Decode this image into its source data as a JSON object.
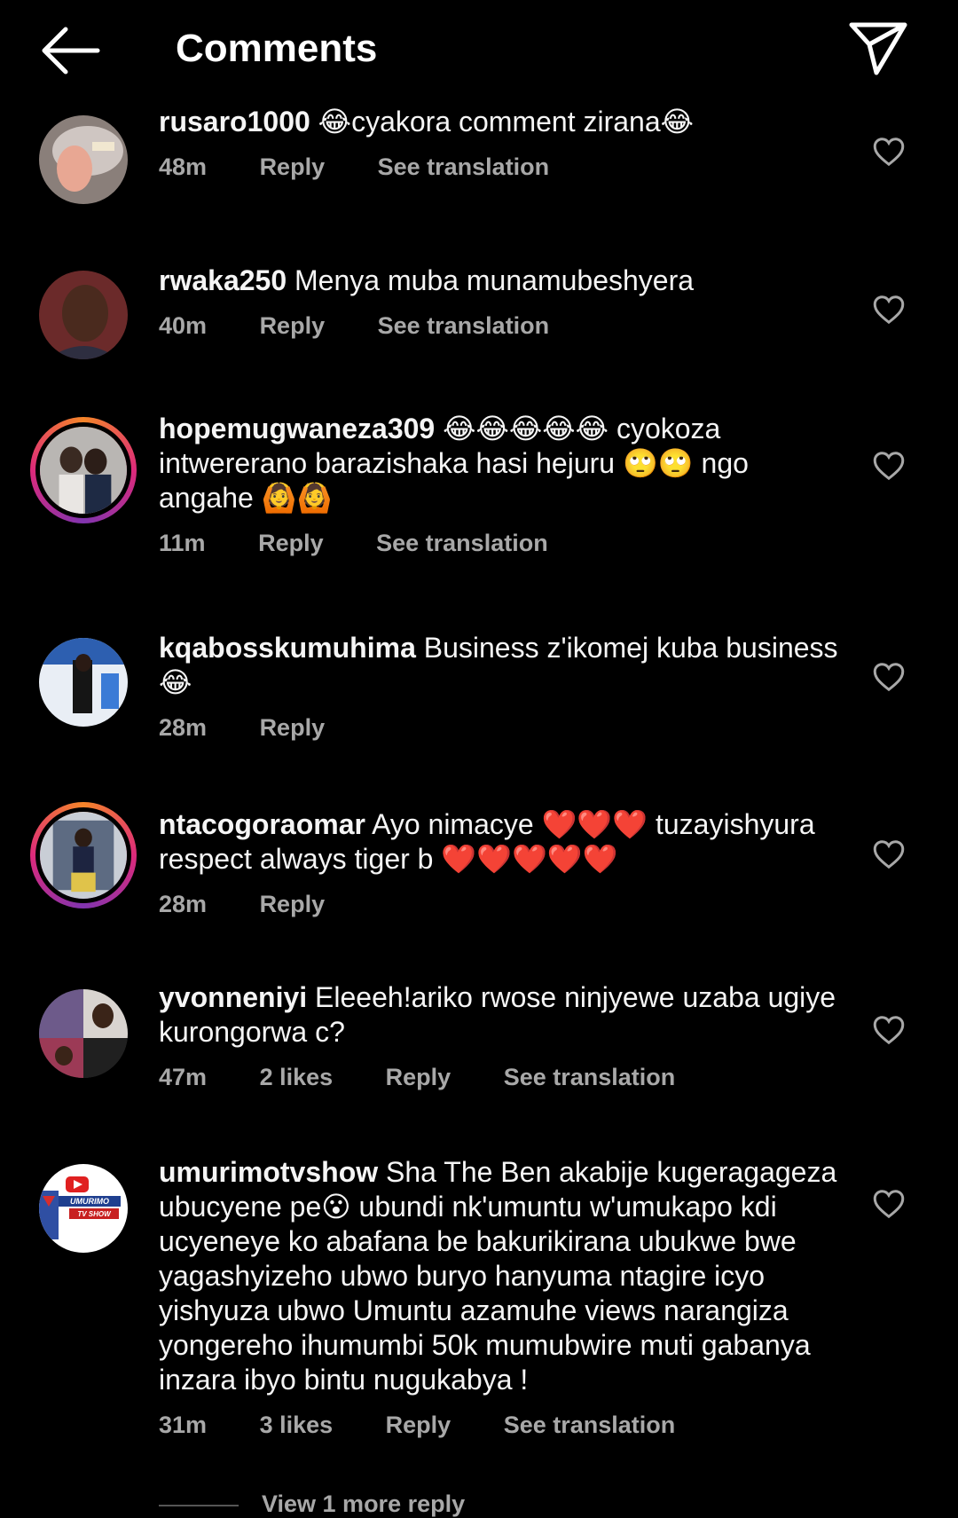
{
  "header": {
    "title": "Comments"
  },
  "meta_labels": {
    "reply": "Reply",
    "see_translation": "See translation"
  },
  "comments": [
    {
      "username": "rusaro1000",
      "text": " 😂cyakora comment zirana😂",
      "time": "48m",
      "likes": "",
      "translate": true,
      "ring": false
    },
    {
      "username": "rwaka250",
      "text": " Menya muba munamubeshyera",
      "time": "40m",
      "likes": "",
      "translate": true,
      "ring": false
    },
    {
      "username": "hopemugwaneza309",
      "text": " 😂😂😂😂😂 cyokoza intwererano barazishaka hasi hejuru 🙄🙄 ngo angahe 🙆🙆",
      "time": "11m",
      "likes": "",
      "translate": true,
      "ring": true
    },
    {
      "username": "kqabosskumuhima",
      "text": " Business z'ikomej kuba business 😂",
      "time": "28m",
      "likes": "",
      "translate": false,
      "ring": false
    },
    {
      "username": "ntacogoraomar",
      "text": " Ayo nimacye ❤️❤️❤️ tuzayishyura respect always tiger b ❤️❤️❤️❤️❤️",
      "time": "28m",
      "likes": "",
      "translate": false,
      "ring": true
    },
    {
      "username": "yvonneniyi",
      "text": " Eleeeh!ariko rwose ninjyewe uzaba ugiye kurongorwa c?",
      "time": "47m",
      "likes": "2 likes",
      "translate": true,
      "ring": false
    },
    {
      "username": "umurimotvshow",
      "text": " Sha The Ben akabije kugeragageza ubucyene pe😮 ubundi nk'umuntu w'umukapo kdi ucyeneye ko abafana be bakurikirana ubukwe bwe yagashyizeho ubwo buryo hanyuma ntagire icyo yishyuza ubwo Umuntu azamuhe views narangiza yongereho ihumumbi 50k  mumubwire muti gabanya inzara ibyo bintu nugukabya !",
      "time": "31m",
      "likes": "3 likes",
      "translate": true,
      "ring": false
    }
  ],
  "view_more_replies": "View 1 more reply",
  "avatar_text": {
    "umurimo_line1": "UMURIMO",
    "umurimo_line2": "TV SHOW"
  },
  "colors": {
    "background": "#000000",
    "meta": "#a8a8a8",
    "story_ring": [
      "#f58529",
      "#dd2a7b",
      "#8134af"
    ]
  }
}
